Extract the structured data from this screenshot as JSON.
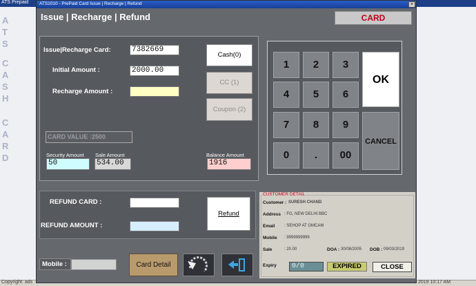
{
  "background": {
    "title": "ATS Prepaid",
    "side_letters": [
      "A",
      "T",
      "S",
      "C",
      "A",
      "S",
      "H",
      "C",
      "A",
      "R",
      "D"
    ],
    "status_left": "Copyright: ads",
    "status_right": "2019  10:17 AM"
  },
  "dialog": {
    "title": "ATS1010 - PrePaid Card Issue | Recharge | Refund",
    "close_glyph": "×",
    "header": "Issue | Recharge | Refund",
    "badge": "CARD"
  },
  "issue": {
    "card_label": "Issue|Recharge Card:",
    "card_value": "7382669",
    "initial_label": "Initial Amount     :",
    "initial_value": "2000.00",
    "recharge_label": "Recharge Amount :",
    "recharge_value": "",
    "cash_button": "Cash(0)",
    "cc_button": "CC (1)",
    "coupon_button": "Coupon (2)",
    "card_value_text": "CARD VALUE :2500",
    "security_label": "Security Amount",
    "security_value": "50",
    "sale_label": "Sale Amount",
    "sale_value": "534.00",
    "balance_label": "Balance Amount",
    "balance_value": "1916"
  },
  "keypad": {
    "keys": [
      "1",
      "2",
      "3",
      "4",
      "5",
      "6",
      "7",
      "8",
      "9",
      "0",
      ".",
      "00"
    ],
    "ok": "OK",
    "cancel": "CANCEL"
  },
  "refund": {
    "card_label": "REFUND CARD  :",
    "amount_label": "REFUND AMOUNT :",
    "button": "Refund"
  },
  "customer": {
    "legend": "CUSTOMER DETAIL",
    "customer_label": "Customer :",
    "customer_value": "SURESH CHAND",
    "address_label": "Address",
    "address_value": ": FG, NEW DELHI BBC",
    "email_label": "Email",
    "email_value": ": SEHOP AT GMCAM",
    "mobile_label": "Mobile",
    "mobile_value": ": 9999999999",
    "sale_label": "Sale",
    "sale_value": ": 20.00",
    "doa_label": "DOA :",
    "doa_value": "30/08/2005",
    "dob_label": "DOB :",
    "dob_value": "09/03/2019",
    "expiry_label": "Expiry",
    "expiry_value": "0/0",
    "expired_badge": "EXPIRED",
    "close_button": "CLOSE"
  },
  "bottom": {
    "mobile_label": "Mobile :",
    "card_detail_button": "Card Detail"
  },
  "colors": {
    "title_bar": "#1d3f88",
    "dialog_bg": "#65686d",
    "card_badge_text": "#c0001a",
    "recharge_input": "#ffffc4",
    "security_input": "#cffcff",
    "sale_input": "#d8d8d8",
    "balance_input": "#ffcfcf",
    "refund_amount_input": "#d7eefe",
    "expired_badge": "#c8cb6f",
    "card_detail_button": "#b89a6d"
  },
  "icons": {
    "refresh": "refresh-icon",
    "exit": "exit-icon"
  }
}
